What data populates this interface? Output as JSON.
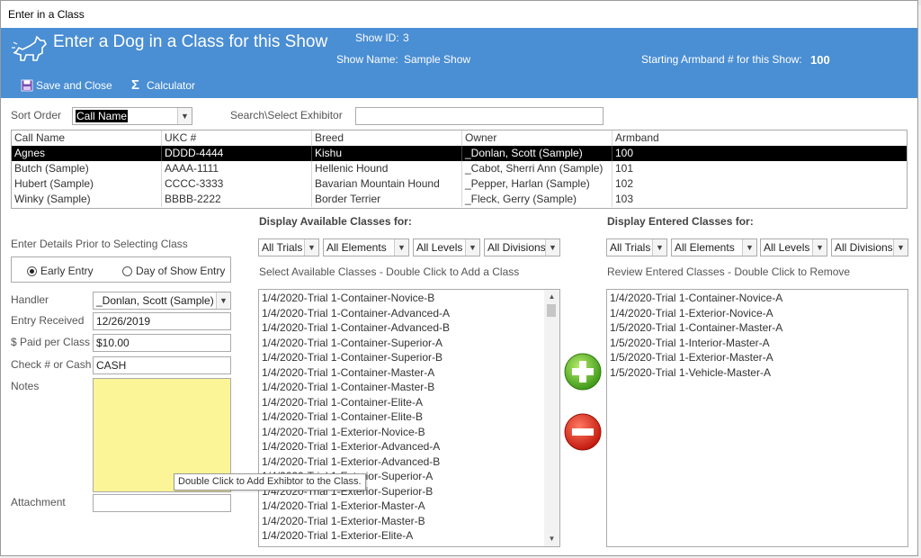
{
  "window": {
    "title": "Enter in a Class"
  },
  "header": {
    "title": "Enter a Dog in a Class for this Show",
    "show_id_label": "Show ID:",
    "show_id_value": "3",
    "show_name_label": "Show Name:",
    "show_name_value": "Sample Show",
    "armband_label": "Starting Armband # for this Show:",
    "armband_value": "100",
    "bg_color": "#4a8ed3"
  },
  "toolbar": {
    "save_label": "Save and Close",
    "calculator_label": "Calculator"
  },
  "sort": {
    "label": "Sort Order",
    "value": "Call Name"
  },
  "search": {
    "label": "Search\\Select Exhibitor",
    "value": ""
  },
  "grid": {
    "columns": [
      "Call Name",
      "UKC #",
      "Breed",
      "Owner",
      "Armband"
    ],
    "rows": [
      {
        "call_name": "Agnes",
        "ukc": "DDDD-4444",
        "breed": "Kishu",
        "owner": "_Donlan, Scott (Sample)",
        "armband": "100",
        "selected": true
      },
      {
        "call_name": "Butch (Sample)",
        "ukc": "AAAA-1111",
        "breed": "Hellenic Hound",
        "owner": "_Cabot, Sherri Ann (Sample)",
        "armband": "101"
      },
      {
        "call_name": "Hubert (Sample)",
        "ukc": "CCCC-3333",
        "breed": "Bavarian Mountain Hound",
        "owner": "_Pepper, Harlan (Sample)",
        "armband": "102"
      },
      {
        "call_name": "Winky (Sample)",
        "ukc": "BBBB-2222",
        "breed": "Border Terrier",
        "owner": "_Fleck, Gerry (Sample)",
        "armband": "103"
      }
    ]
  },
  "details": {
    "heading": "Enter Details Prior to Selecting Class",
    "early_entry": "Early Entry",
    "day_of_show": "Day of Show Entry",
    "handler_label": "Handler",
    "handler_value": "_Donlan, Scott (Sample)",
    "entry_received_label": "Entry Received",
    "entry_received_value": "12/26/2019",
    "paid_label": "$ Paid per Class",
    "paid_value": "$10.00",
    "check_label": "Check # or Cash",
    "check_value": "CASH",
    "notes_label": "Notes",
    "attachment_label": "Attachment"
  },
  "available": {
    "heading": "Display Available Classes for:",
    "filters": [
      "All Trials",
      "All Elements",
      "All Levels",
      "All Divisions"
    ],
    "instruction": "Select Available Classes - Double Click to Add a Class",
    "items": [
      "1/4/2020-Trial 1-Container-Novice-B",
      "1/4/2020-Trial 1-Container-Advanced-A",
      "1/4/2020-Trial 1-Container-Advanced-B",
      "1/4/2020-Trial 1-Container-Superior-A",
      "1/4/2020-Trial 1-Container-Superior-B",
      "1/4/2020-Trial 1-Container-Master-A",
      "1/4/2020-Trial 1-Container-Master-B",
      "1/4/2020-Trial 1-Container-Elite-A",
      "1/4/2020-Trial 1-Container-Elite-B",
      "1/4/2020-Trial 1-Exterior-Novice-B",
      "1/4/2020-Trial 1-Exterior-Advanced-A",
      "1/4/2020-Trial 1-Exterior-Advanced-B",
      "1/4/2020-Trial 1-Exterior-Superior-A",
      "1/4/2020-Trial 1-Exterior-Superior-B",
      "1/4/2020-Trial 1-Exterior-Master-A",
      "1/4/2020-Trial 1-Exterior-Master-B",
      "1/4/2020-Trial 1-Exterior-Elite-A"
    ]
  },
  "entered": {
    "heading": "Display Entered Classes for:",
    "filters": [
      "All Trials",
      "All Elements",
      "All Levels",
      "All Divisions"
    ],
    "instruction": "Review Entered Classes  - Double Click to Remove",
    "items": [
      "1/4/2020-Trial 1-Container-Novice-A",
      "1/4/2020-Trial 1-Exterior-Novice-A",
      "1/5/2020-Trial 1-Container-Master-A",
      "1/5/2020-Trial 1-Interior-Master-A",
      "1/5/2020-Trial 1-Exterior-Master-A",
      "1/5/2020-Trial 1-Vehicle-Master-A"
    ]
  },
  "tooltip": "Double Click to Add Exhibtor to the Class.",
  "colors": {
    "add": "#5cb82a",
    "remove": "#d92b1e",
    "notes": "#fbf598"
  }
}
